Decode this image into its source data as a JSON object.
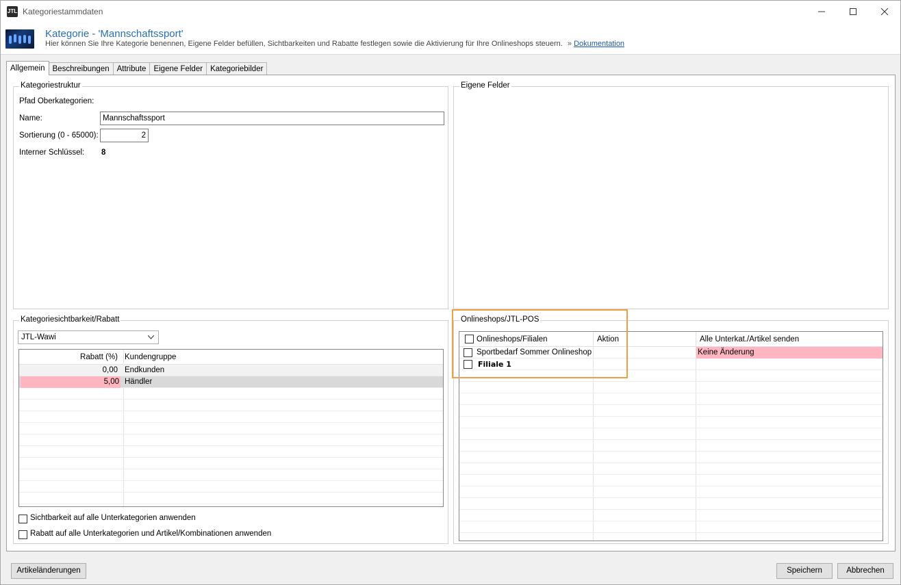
{
  "window": {
    "title": "Kategoriestammdaten",
    "app_icon_text": "JTL"
  },
  "header": {
    "title": "Kategorie - 'Mannschaftssport'",
    "subtitle": "Hier können Sie Ihre Kategorie benennen, Eigene Felder befüllen, Sichtbarkeiten und Rabatte festlegen sowie die Aktivierung für Ihre Onlineshops steuern.",
    "link_prefix": "»",
    "link_label": "Dokumentation"
  },
  "tabs": [
    {
      "label": "Allgemein",
      "active": true
    },
    {
      "label": "Beschreibungen",
      "active": false
    },
    {
      "label": "Attribute",
      "active": false
    },
    {
      "label": "Eigene Felder",
      "active": false
    },
    {
      "label": "Kategoriebilder",
      "active": false
    }
  ],
  "kategoriestruktur": {
    "group_label": "Kategoriestruktur",
    "pfad_label": "Pfad Oberkategorien:",
    "name_label": "Name:",
    "name_value": "Mannschaftssport",
    "sortierung_label": "Sortierung (0 - 65000):",
    "sortierung_value": "2",
    "schluessel_label": "Interner Schlüssel:",
    "schluessel_value": "8"
  },
  "eigene_felder": {
    "group_label": "Eigene Felder"
  },
  "sichtbarkeit": {
    "group_label": "Kategoriesichtbarkeit/Rabatt",
    "combo_value": "JTL-Wawi",
    "columns": [
      "Rabatt (%)",
      "Kundengruppe"
    ],
    "rows": [
      {
        "rabatt": "0,00",
        "gruppe": "Endkunden"
      },
      {
        "rabatt": "5,00",
        "gruppe": "Händler"
      }
    ],
    "check_sichtbarkeit": "Sichtbarkeit auf alle Unterkategorien anwenden",
    "check_rabatt": "Rabatt auf alle Unterkategorien und Artikel/Kombinationen anwenden"
  },
  "onlineshops": {
    "group_label": "Onlineshops/JTL-POS",
    "columns": [
      "Onlineshops/Filialen",
      "Aktion",
      "Alle Unterkat./Artikel senden"
    ],
    "rows": [
      {
        "name": "Sportbedarf Sommer Onlineshop",
        "aktion": "",
        "senden": "Keine Änderung"
      },
      {
        "name": "Filiale 1",
        "aktion": "",
        "senden": ""
      }
    ]
  },
  "footer": {
    "artikel_button": "Artikeländerungen",
    "save_button": "Speichern",
    "cancel_button": "Abbrechen"
  },
  "colors": {
    "accent_title": "#2a6eb7",
    "row_pink": "#ffb6c1",
    "row_selected_gray": "#d9d9d9",
    "highlight_orange": "#f0a044"
  }
}
